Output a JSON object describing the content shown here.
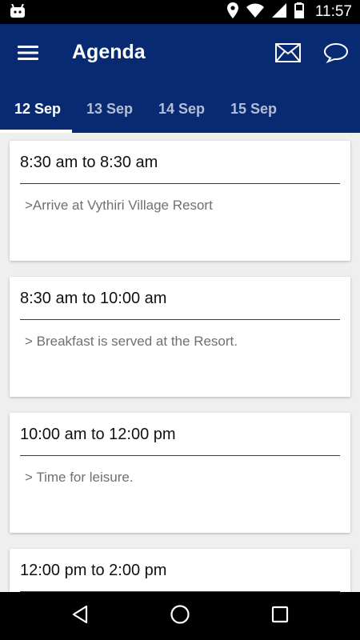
{
  "status_bar": {
    "time": "11:57",
    "icons": [
      "android-icon",
      "location-icon",
      "wifi-icon",
      "signal-icon",
      "battery-icon"
    ]
  },
  "app_bar": {
    "title": "Agenda",
    "icons": [
      "menu-icon",
      "mail-icon",
      "chat-icon"
    ]
  },
  "tabs": [
    {
      "label": "12 Sep",
      "active": true
    },
    {
      "label": "13 Sep",
      "active": false
    },
    {
      "label": "14 Sep",
      "active": false
    },
    {
      "label": "15 Sep",
      "active": false
    }
  ],
  "agenda": [
    {
      "time": "8:30 am to 8:30 am",
      "description": ">Arrive at Vythiri Village Resort"
    },
    {
      "time": "8:30 am to 10:00 am",
      "description": "> Breakfast is served at the Resort."
    },
    {
      "time": "10:00 am to 12:00 pm",
      "description": "> Time for leisure."
    },
    {
      "time": "12:00 pm to 2:00 pm",
      "description": ""
    }
  ],
  "nav_bar": {
    "icons": [
      "back-icon",
      "home-icon",
      "recents-icon"
    ]
  },
  "colors": {
    "primary": "#072a73",
    "tab_inactive": "#b3bdd6",
    "background": "#efefef",
    "divider": "#1a3a8a"
  }
}
